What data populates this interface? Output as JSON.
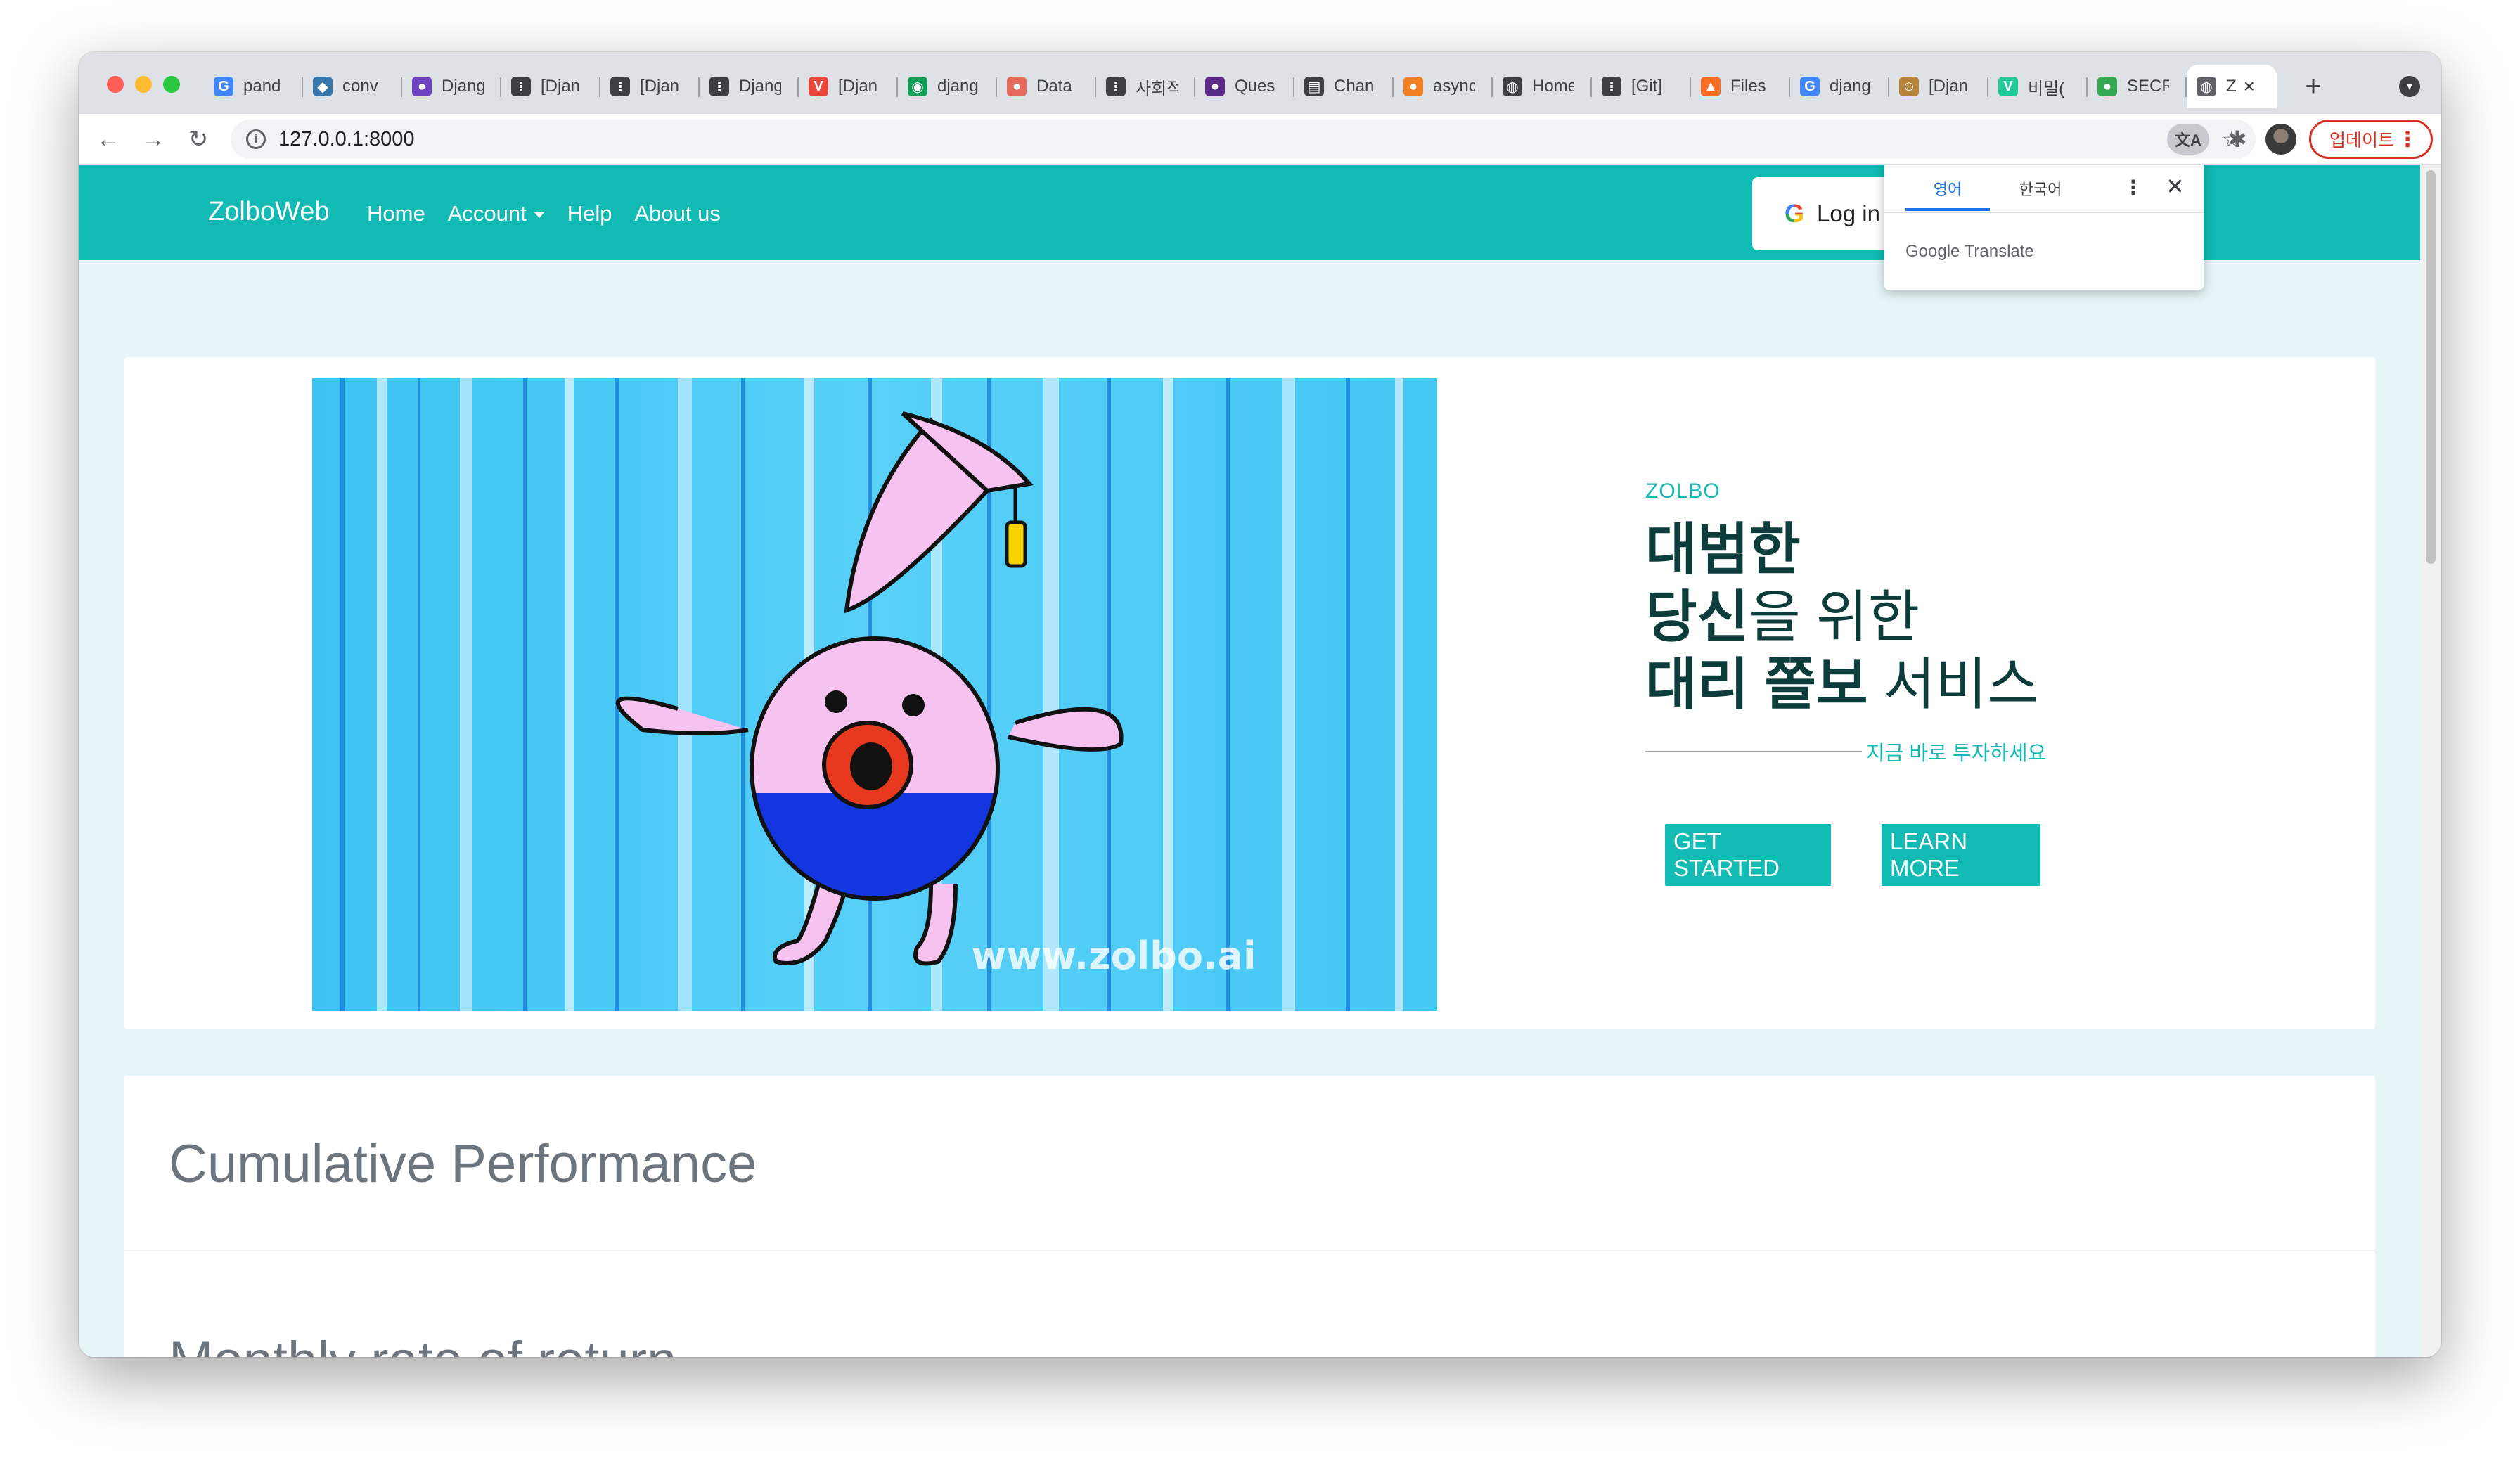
{
  "browser": {
    "tabs": [
      {
        "label": "pand",
        "icon": "google-icon",
        "color": "#4285f4"
      },
      {
        "label": "conv",
        "icon": "python-icon",
        "color": "#3776ab"
      },
      {
        "label": "Djang",
        "icon": "generic-site-icon",
        "color": "#6f42c1"
      },
      {
        "label": "[Djan",
        "icon": "velog-dots-icon",
        "color": "#3c4043"
      },
      {
        "label": "[Djan",
        "icon": "velog-dots-icon",
        "color": "#3c4043"
      },
      {
        "label": "Djang",
        "icon": "velog-dots-icon",
        "color": "#3c4043"
      },
      {
        "label": "[Djan",
        "icon": "v-logo-icon",
        "color": "#e8453c"
      },
      {
        "label": "djang",
        "icon": "stackoverflow-icon",
        "color": "#0f9d58"
      },
      {
        "label": "Data",
        "icon": "generic-site-icon",
        "color": "#e66a5c"
      },
      {
        "label": "사회적",
        "icon": "velog-dots-icon",
        "color": "#3c4043"
      },
      {
        "label": "Ques",
        "icon": "generic-site-icon",
        "color": "#5b2a86"
      },
      {
        "label": "Chan",
        "icon": "document-icon",
        "color": "#3c4043"
      },
      {
        "label": "async",
        "icon": "generic-site-icon",
        "color": "#f48024"
      },
      {
        "label": "Home",
        "icon": "globe-icon",
        "color": "#3c4043"
      },
      {
        "label": "[Git]",
        "icon": "velog-dots-icon",
        "color": "#3c4043"
      },
      {
        "label": "Files",
        "icon": "gitlab-icon",
        "color": "#fc6d26"
      },
      {
        "label": "djang",
        "icon": "google-icon",
        "color": "#4285f4"
      },
      {
        "label": "[Djan",
        "icon": "avatar-icon",
        "color": "#b5843a"
      },
      {
        "label": "비밀(",
        "icon": "v-logo-icon",
        "color": "#20c997"
      },
      {
        "label": "SECR",
        "icon": "generic-site-icon",
        "color": "#34a853"
      }
    ],
    "active_tab": {
      "label": "Z",
      "icon": "globe-icon"
    },
    "new_tab_label": "+",
    "url": "127.0.0.1:8000",
    "update_label": "업데이트"
  },
  "translate_popup": {
    "lang_english": "영어",
    "lang_korean": "한국어",
    "brand": "Google Translate"
  },
  "site": {
    "brand": "ZolboWeb",
    "nav": {
      "home": "Home",
      "account": "Account",
      "help": "Help",
      "about": "About us"
    },
    "login_label": "Log in",
    "hero": {
      "eyebrow": "ZOLBO",
      "line1_bold": "대범한",
      "line2_bold": "당신",
      "line2_rest": "을 위한",
      "line3_bold": "대리 쫄보",
      "line3_rest": " 서비스",
      "subline": "지금 바로 투자하세요",
      "image_watermark": "www.zolbo.ai"
    },
    "buttons": {
      "get_started": "GET STARTED",
      "learn_more": "LEARN MORE"
    },
    "sections": {
      "cumulative": "Cumulative Performance",
      "monthly": "Monthly rate of return"
    }
  },
  "colors": {
    "brand_teal": "#11bab3",
    "headline_dark": "#0c3d3a",
    "update_red": "#d93025"
  }
}
